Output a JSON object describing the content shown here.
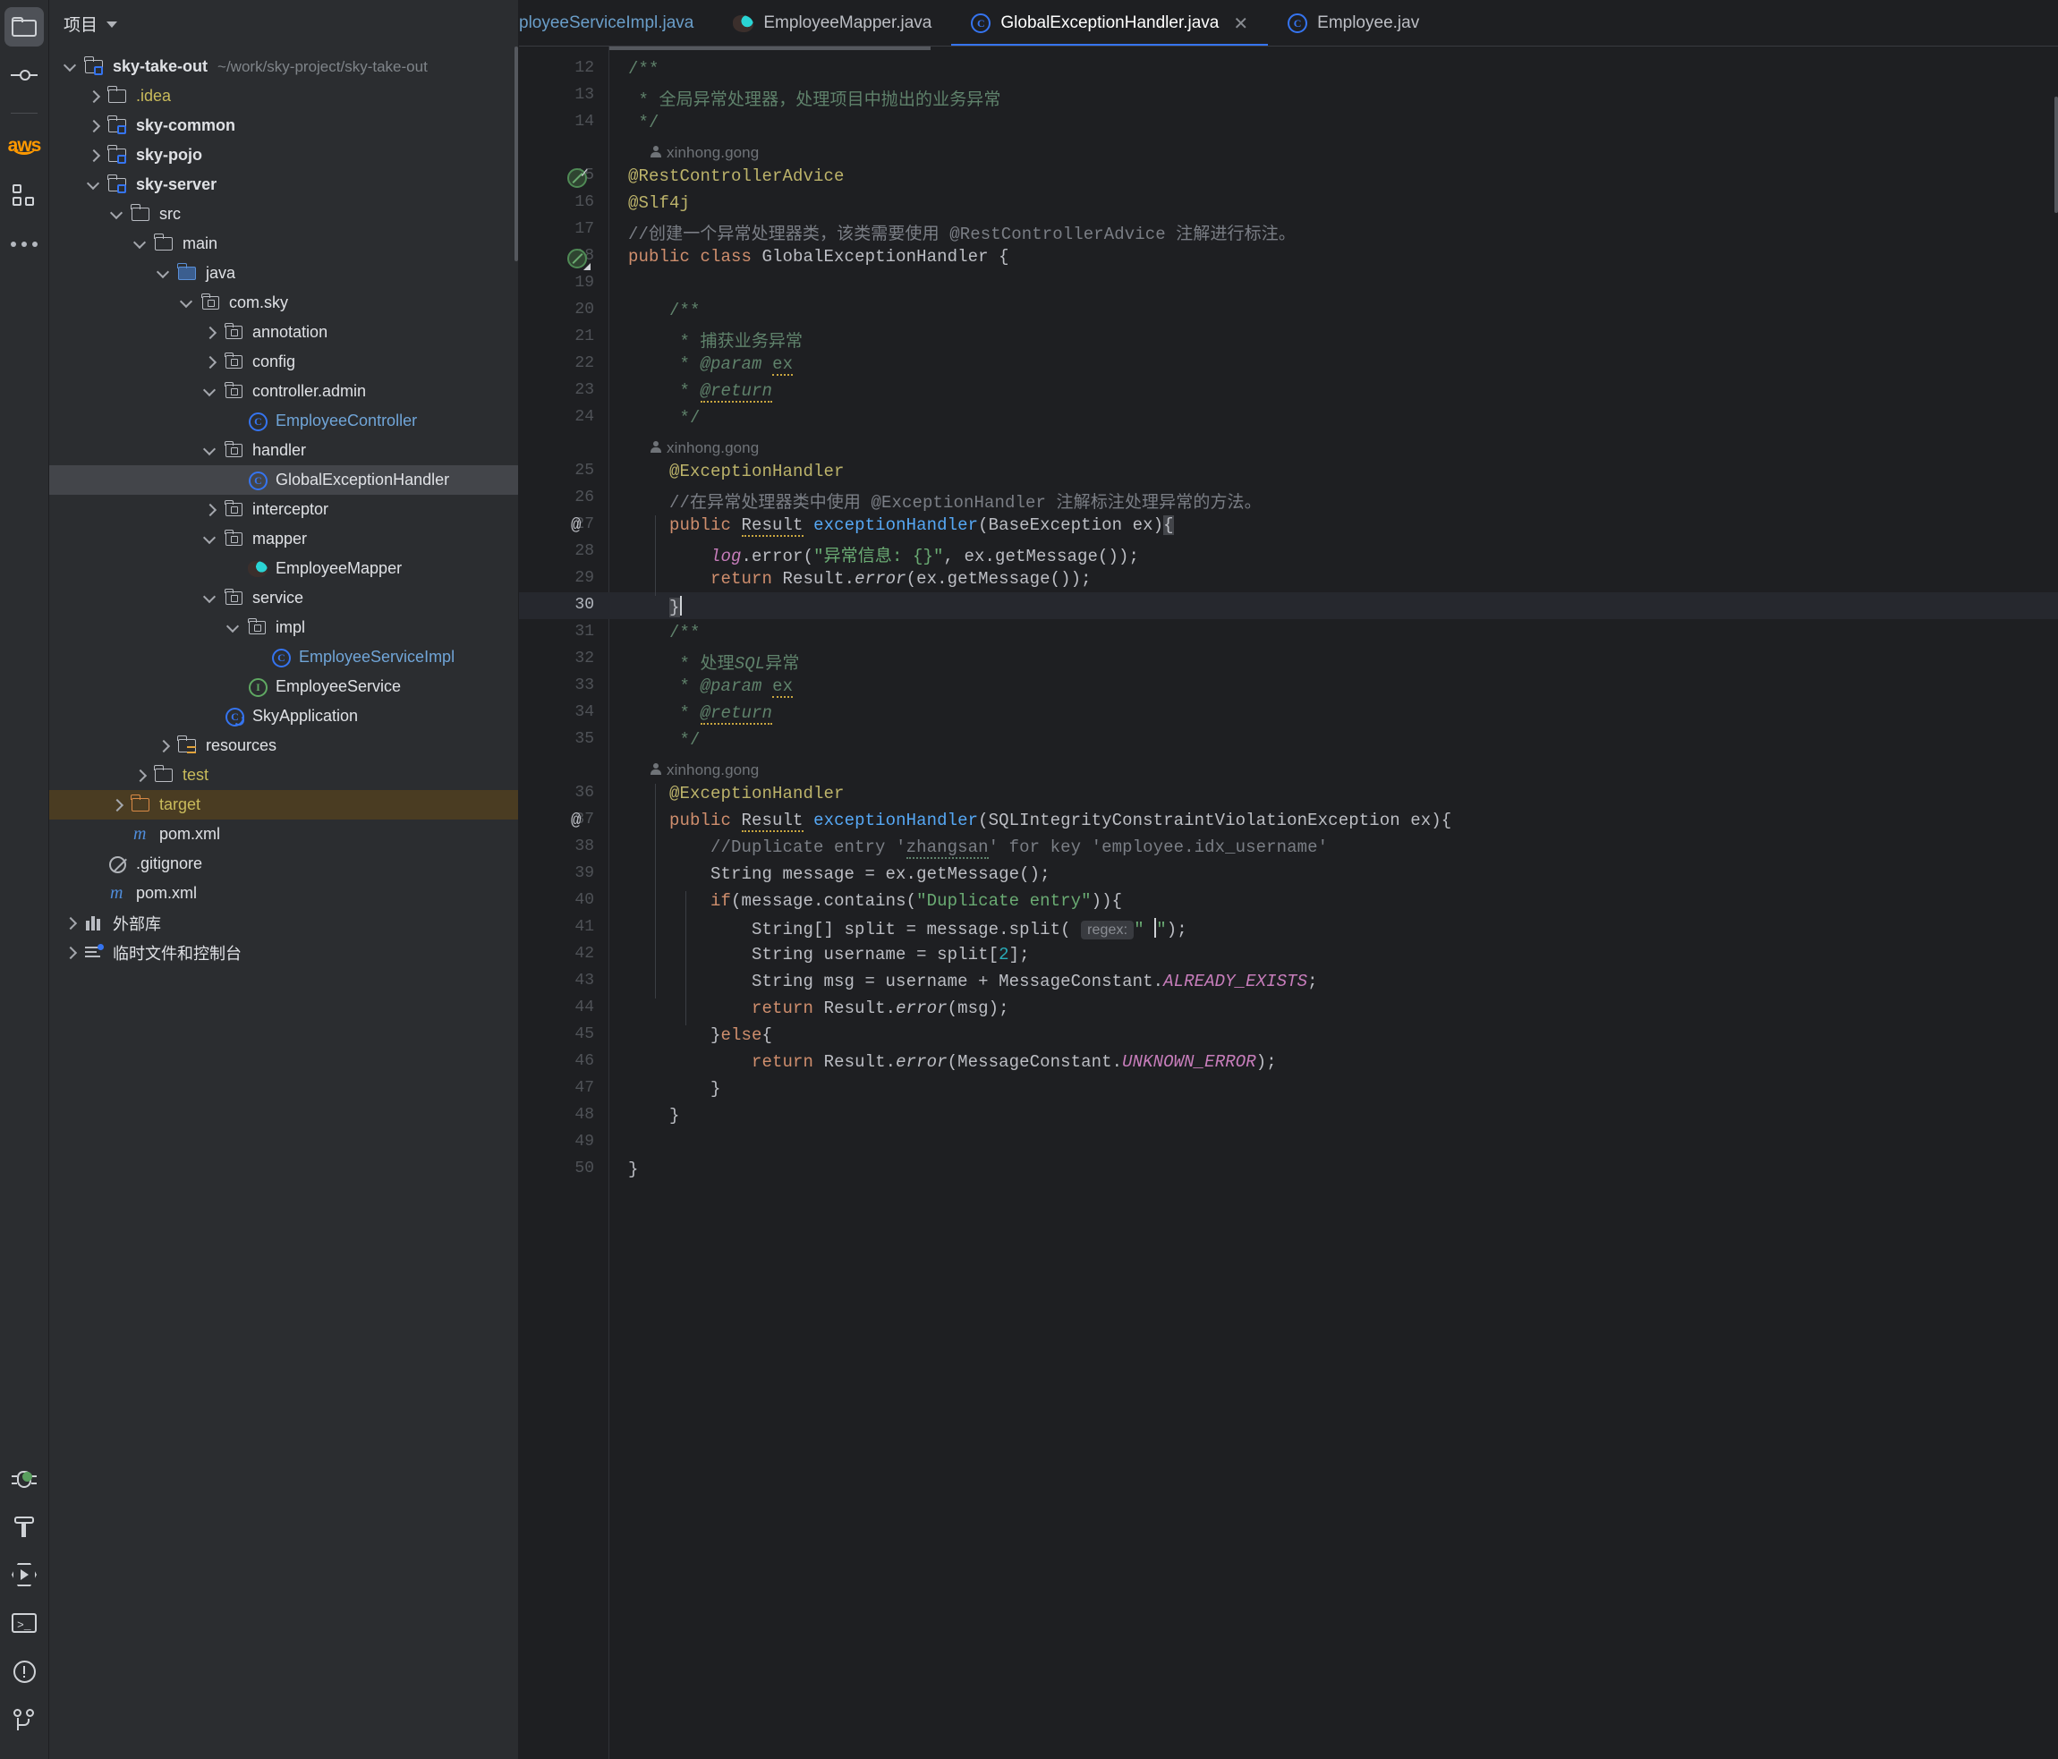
{
  "activitybar": {
    "items": [
      {
        "name": "project-icon",
        "label": "Project",
        "active": true
      },
      {
        "name": "commit-icon",
        "label": "Commit",
        "active": false
      },
      {
        "name": "aws-icon",
        "label": "aws",
        "active": false
      },
      {
        "name": "plugins-icon",
        "label": "Plugins",
        "active": false
      },
      {
        "name": "more-icon",
        "label": "More",
        "active": false
      }
    ],
    "bottom_items": [
      {
        "name": "debug-icon",
        "label": "Debug",
        "badge": true
      },
      {
        "name": "build-icon",
        "label": "Build"
      },
      {
        "name": "run-icon",
        "label": "Run"
      },
      {
        "name": "terminal-icon",
        "label": "Terminal"
      },
      {
        "name": "problems-icon",
        "label": "Problems"
      },
      {
        "name": "version-control-icon",
        "label": "Version Control"
      }
    ]
  },
  "sidebar": {
    "title": "项目",
    "tree": [
      {
        "depth": 0,
        "arrow": "expanded",
        "icon": "module",
        "label": "sky-take-out",
        "bold": true,
        "color": "white",
        "path": "~/work/sky-project/sky-take-out"
      },
      {
        "depth": 1,
        "arrow": "collapsed",
        "icon": "folder",
        "label": ".idea",
        "color": "yellow"
      },
      {
        "depth": 1,
        "arrow": "collapsed",
        "icon": "module",
        "label": "sky-common",
        "bold": true,
        "color": "white"
      },
      {
        "depth": 1,
        "arrow": "collapsed",
        "icon": "module",
        "label": "sky-pojo",
        "bold": true,
        "color": "white"
      },
      {
        "depth": 1,
        "arrow": "expanded",
        "icon": "module",
        "label": "sky-server",
        "bold": true,
        "color": "white"
      },
      {
        "depth": 2,
        "arrow": "expanded",
        "icon": "folder",
        "label": "src",
        "color": "white"
      },
      {
        "depth": 3,
        "arrow": "expanded",
        "icon": "folder",
        "label": "main",
        "color": "white"
      },
      {
        "depth": 4,
        "arrow": "expanded",
        "icon": "folder-source",
        "label": "java",
        "color": "white"
      },
      {
        "depth": 5,
        "arrow": "expanded",
        "icon": "package",
        "label": "com.sky",
        "color": "white"
      },
      {
        "depth": 6,
        "arrow": "collapsed",
        "icon": "package",
        "label": "annotation",
        "color": "white"
      },
      {
        "depth": 6,
        "arrow": "collapsed",
        "icon": "package",
        "label": "config",
        "color": "white"
      },
      {
        "depth": 6,
        "arrow": "expanded",
        "icon": "package",
        "label": "controller.admin",
        "color": "white"
      },
      {
        "depth": 7,
        "arrow": "none",
        "icon": "class",
        "label": "EmployeeController",
        "color": "blueish"
      },
      {
        "depth": 6,
        "arrow": "expanded",
        "icon": "package",
        "label": "handler",
        "color": "white"
      },
      {
        "depth": 7,
        "arrow": "none",
        "icon": "class",
        "label": "GlobalExceptionHandler",
        "color": "white",
        "selected": true
      },
      {
        "depth": 6,
        "arrow": "collapsed",
        "icon": "package",
        "label": "interceptor",
        "color": "white"
      },
      {
        "depth": 6,
        "arrow": "expanded",
        "icon": "package",
        "label": "mapper",
        "color": "white"
      },
      {
        "depth": 7,
        "arrow": "none",
        "icon": "mybatis",
        "label": "EmployeeMapper",
        "color": "white"
      },
      {
        "depth": 6,
        "arrow": "expanded",
        "icon": "package",
        "label": "service",
        "color": "white"
      },
      {
        "depth": 7,
        "arrow": "expanded",
        "icon": "package",
        "label": "impl",
        "color": "white"
      },
      {
        "depth": 8,
        "arrow": "none",
        "icon": "class",
        "label": "EmployeeServiceImpl",
        "color": "blueish"
      },
      {
        "depth": 7,
        "arrow": "none",
        "icon": "interface",
        "label": "EmployeeService",
        "color": "white"
      },
      {
        "depth": 6,
        "arrow": "none",
        "icon": "spring-class",
        "label": "SkyApplication",
        "color": "white"
      },
      {
        "depth": 4,
        "arrow": "collapsed",
        "icon": "folder-resources",
        "label": "resources",
        "color": "white"
      },
      {
        "depth": 3,
        "arrow": "collapsed",
        "icon": "folder",
        "label": "test",
        "color": "yellow"
      },
      {
        "depth": 2,
        "arrow": "collapsed",
        "icon": "folder-orange",
        "label": "target",
        "color": "yellow",
        "highlight": "target"
      },
      {
        "depth": 2,
        "arrow": "none",
        "icon": "maven",
        "label": "pom.xml",
        "color": "white"
      },
      {
        "depth": 1,
        "arrow": "none",
        "icon": "gitignore",
        "label": ".gitignore",
        "color": "white"
      },
      {
        "depth": 1,
        "arrow": "none",
        "icon": "maven",
        "label": "pom.xml",
        "color": "white"
      },
      {
        "depth": 0,
        "arrow": "collapsed",
        "icon": "library",
        "label": "外部库",
        "color": "white"
      },
      {
        "depth": 0,
        "arrow": "collapsed",
        "icon": "scratch",
        "label": "临时文件和控制台",
        "color": "white"
      }
    ]
  },
  "tabs": [
    {
      "label": "ployeeServiceImpl.java",
      "icon": "class-icon",
      "active": false,
      "truncated": true
    },
    {
      "label": "EmployeeMapper.java",
      "icon": "mybatis-icon",
      "active": false
    },
    {
      "label": "GlobalExceptionHandler.java",
      "icon": "class-icon",
      "active": true,
      "closable": true
    },
    {
      "label": "Employee.jav",
      "icon": "class-icon",
      "active": false,
      "truncated": true
    }
  ],
  "editor": {
    "close_label": "✕",
    "current_line": 30,
    "author_tag": "xinhong.gong",
    "hint_regex": "regex:",
    "lines": [
      {
        "num": 12,
        "indent": 0,
        "html": "<span class='cm'>/**</span>"
      },
      {
        "num": 13,
        "indent": 0,
        "html": "<span class='cm'> * 全局异常处理器，处理项目中抛出的业务异常</span>"
      },
      {
        "num": 14,
        "indent": 0,
        "html": "<span class='cm'> */</span>"
      },
      {
        "num": null,
        "indent": 0,
        "author": true
      },
      {
        "num": 15,
        "indent": 0,
        "gutter": "green-check",
        "html": "<span class='an'>@RestControllerAdvice</span>"
      },
      {
        "num": 16,
        "indent": 0,
        "html": "<span class='an'>@Slf4j</span>"
      },
      {
        "num": 17,
        "indent": 0,
        "html": "<span class='cl'>//创建一个异常处理器类，该类需要使用 @RestControllerAdvice 注解进行标注。</span>"
      },
      {
        "num": 18,
        "indent": 0,
        "gutter": "green-tri",
        "html": "<span class='k'>public class</span> <span class='wh'>GlobalExceptionHandler</span> {"
      },
      {
        "num": 19,
        "indent": 0,
        "html": ""
      },
      {
        "num": 20,
        "indent": 0,
        "html": "    <span class='cm'>/**</span>"
      },
      {
        "num": 21,
        "indent": 0,
        "html": "     <span class='cm'>* 捕获业务异常</span>"
      },
      {
        "num": 22,
        "indent": 0,
        "html": "     <span class='cm'>* </span><span class='tag'>@param</span> <span class='cm squig'>ex</span>"
      },
      {
        "num": 23,
        "indent": 0,
        "html": "     <span class='cm'>* </span><span class='tag squig'>@return</span>"
      },
      {
        "num": 24,
        "indent": 0,
        "html": "     <span class='cm'>*/</span>"
      },
      {
        "num": null,
        "indent": 1,
        "author": true
      },
      {
        "num": 25,
        "indent": 0,
        "html": "    <span class='an'>@ExceptionHandler</span>"
      },
      {
        "num": 26,
        "indent": 0,
        "html": "    <span class='cl'>//在异常处理器类中使用 @ExceptionHandler 注解标注处理异常的方法。</span>"
      },
      {
        "num": 27,
        "indent": 0,
        "gutter": "at",
        "html": "    <span class='k'>public</span> <span class='wh squig'>Result</span> <span class='mt'>exceptionHandler</span>(<span class='wh'>BaseException</span> ex)<span class='selbox'>{</span>"
      },
      {
        "num": 28,
        "indent": 0,
        "html": "        <span class='fi'>log</span>.<span class='wh'>error</span>(<span class='st'>\"异常信息: {}\"</span>, ex.<span class='wh'>getMessage</span>());"
      },
      {
        "num": 29,
        "indent": 0,
        "html": "        <span class='k'>return</span> <span class='wh'>Result</span>.<span class='it'>error</span>(ex.<span class='wh'>getMessage</span>());"
      },
      {
        "num": 30,
        "indent": 0,
        "current": true,
        "html": "    <span class='selbox'>}</span><span class='caret'></span>"
      },
      {
        "num": 31,
        "indent": 0,
        "html": "    <span class='cm'>/**</span>"
      },
      {
        "num": 32,
        "indent": 0,
        "html": "     <span class='cm'>* 处理</span><span class='cm' style='font-style:italic'>SQL</span><span class='cm'>异常</span>"
      },
      {
        "num": 33,
        "indent": 0,
        "html": "     <span class='cm'>* </span><span class='tag'>@param</span> <span class='cm squig'>ex</span>"
      },
      {
        "num": 34,
        "indent": 0,
        "html": "     <span class='cm'>* </span><span class='tag squig'>@return</span>"
      },
      {
        "num": 35,
        "indent": 0,
        "html": "     <span class='cm'>*/</span>"
      },
      {
        "num": null,
        "indent": 1,
        "author": true
      },
      {
        "num": 36,
        "indent": 0,
        "html": "    <span class='an'>@ExceptionHandler</span>"
      },
      {
        "num": 37,
        "indent": 0,
        "gutter": "at",
        "html": "    <span class='k'>public</span> <span class='wh squig'>Result</span> <span class='mt'>exceptionHandler</span>(<span class='wh'>SQLIntegrityConstraintViolationException</span> ex){"
      },
      {
        "num": 38,
        "indent": 0,
        "html": "        <span class='cl'>//Duplicate entry '</span><span class='cl squig-g'>zhangsan</span><span class='cl'>' for key 'employee.idx_username'</span>"
      },
      {
        "num": 39,
        "indent": 0,
        "html": "        <span class='wh'>String</span> message = ex.<span class='wh'>getMessage</span>();"
      },
      {
        "num": 40,
        "indent": 0,
        "html": "        <span class='k'>if</span>(message.<span class='wh'>contains</span>(<span class='st'>\"Duplicate entry\"</span>)){"
      },
      {
        "num": 41,
        "indent": 0,
        "hint": true,
        "html": "            <span class='wh'>String</span>[] split = message.<span class='wh'>split</span>( "
      },
      {
        "num": 42,
        "indent": 0,
        "html": "            <span class='wh'>String</span> username = split[<span class='nm'>2</span>];"
      },
      {
        "num": 43,
        "indent": 0,
        "html": "            <span class='wh'>String</span> msg = username + <span class='wh'>MessageConstant</span>.<span class='sf'>ALREADY_EXISTS</span>;"
      },
      {
        "num": 44,
        "indent": 0,
        "html": "            <span class='k'>return</span> <span class='wh'>Result</span>.<span class='it'>error</span>(msg);"
      },
      {
        "num": 45,
        "indent": 0,
        "html": "        }<span class='k'>else</span>{"
      },
      {
        "num": 46,
        "indent": 0,
        "html": "            <span class='k'>return</span> <span class='wh'>Result</span>.<span class='it'>error</span>(<span class='wh'>MessageConstant</span>.<span class='sf'>UNKNOWN_ERROR</span>);"
      },
      {
        "num": 47,
        "indent": 0,
        "html": "        }"
      },
      {
        "num": 48,
        "indent": 0,
        "html": "    }"
      },
      {
        "num": 49,
        "indent": 0,
        "html": ""
      },
      {
        "num": 50,
        "indent": 0,
        "html": "}"
      }
    ],
    "line41_tail": "<span class='st'>\" </span><span class='caret'></span><span class='st'>\"</span>);"
  },
  "colors": {
    "accent": "#3574f0",
    "sidebar_bg": "#2b2d30",
    "editor_bg": "#1e1f22",
    "selection": "#43454a",
    "target_highlight": "#4a3c22",
    "keyword": "#cf8e6d",
    "annotation": "#bcb36a",
    "comment": "#5f826b",
    "string": "#6aab73",
    "method": "#56a8f5",
    "field": "#c77dbb",
    "number": "#2aacb8",
    "aws_orange": "#ff9900",
    "green_badge": "#599e5e"
  }
}
